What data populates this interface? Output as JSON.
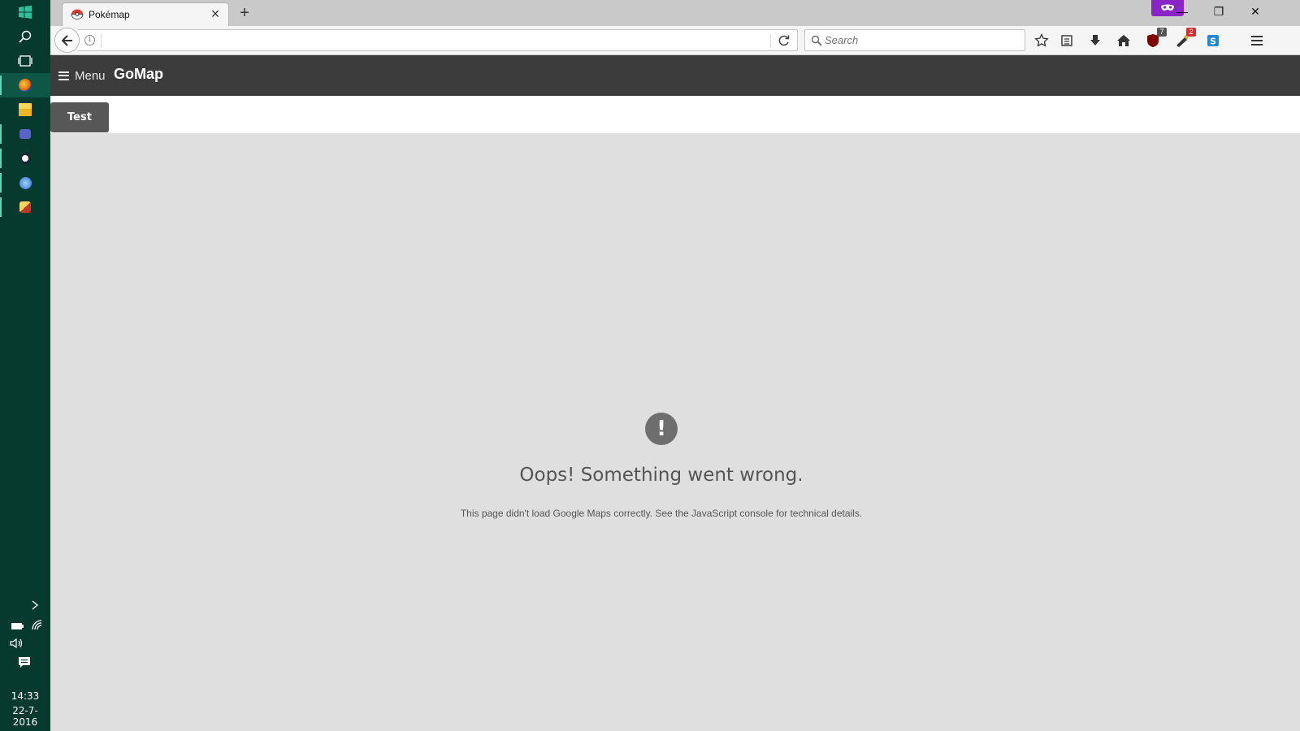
{
  "browser": {
    "tab_title": "Pokémap",
    "tab_close": "×",
    "new_tab": "+",
    "search_placeholder": "Search",
    "badges": {
      "ublock": "7",
      "extension": "2"
    },
    "window_controls": {
      "minimize": "—",
      "restore": "❐",
      "close": "✕"
    },
    "privacy_color": "#8b24c8"
  },
  "page": {
    "menu_label": "Menu",
    "brand": "GoMap",
    "test_button": "Test",
    "error_icon": "!",
    "error_title": "Oops! Something went wrong.",
    "error_detail": "This page didn't load Google Maps correctly. See the JavaScript console for technical details."
  },
  "taskbar": {
    "time": "14:33",
    "date": "22-7-2016",
    "accent": "#063a2f"
  }
}
